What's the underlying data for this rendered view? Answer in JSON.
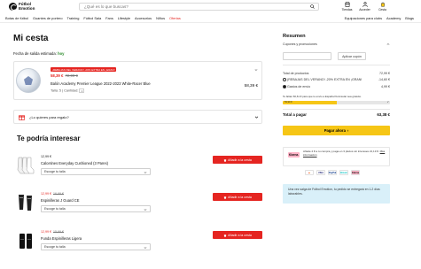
{
  "header": {
    "logo_text": "Fútbol Emotion",
    "search_placeholder": "¿Qué es lo que buscas?",
    "icons": [
      {
        "name": "tiendas",
        "label": "Tiendas",
        "icon": "store-icon"
      },
      {
        "name": "acceder",
        "label": "Acceder",
        "icon": "user-icon"
      },
      {
        "name": "cesta",
        "label": "Cesta",
        "icon": "cart-icon"
      }
    ]
  },
  "nav": {
    "left": [
      "Botas de fútbol",
      "Guantes de portero",
      "Training",
      "Fútbol Sala",
      "Fans",
      "Lifestyle",
      "Accesorios",
      "Niños",
      "Ofertas"
    ],
    "right": [
      "Equipaciones para clubs",
      "Academy",
      "Blogs"
    ]
  },
  "cart": {
    "title": "Mi cesta",
    "delivery_label": "Fecha de salida estimada:",
    "delivery_value": "hoy",
    "item": {
      "badge": "¡REBAJAS DEL VERANO! -20% EXTRA EN ¡GRAN!",
      "price_new": "58,39 €",
      "price_old": "72,99 €",
      "name": "Balón Academy Premier League 2022-2023 White-Racer Blue",
      "meta_size": "Talla: 5",
      "meta_qty_label": "Cantidad:",
      "qty": "1",
      "total": "58,39 €"
    },
    "gift_label": "¿Lo quieres para regalo?"
  },
  "recommend": {
    "title": "Te podría interesar",
    "items": [
      {
        "price_new": "12,99 €",
        "price_old": "",
        "name": "Calcetines Everyday Cushioned (3 Pares)",
        "select": "Escoge tu talla",
        "button": "Añadir a la cesta",
        "icon": "socks-icon"
      },
      {
        "price_new": "12,99 €",
        "price_old": "16,99 €",
        "name": "Espinilleras J Guard CE",
        "select": "Escoge tu talla",
        "button": "Añadir a la cesta",
        "icon": "shinguards-icon"
      },
      {
        "price_new": "12,99 €",
        "price_old": "15,99 €",
        "name": "Funda Espinilleras Ligera",
        "select": "Escoge tu talla",
        "button": "Añadir a la cesta",
        "icon": "sleeves-icon"
      }
    ]
  },
  "summary": {
    "title": "Resumen",
    "coupon_label": "Cupones y promociones",
    "coupon_button": "Aplicar cupón",
    "lines": [
      {
        "label": "Total de productos",
        "value": "72,99 €"
      },
      {
        "label": "(REBAJAS DEL VERANO! -20% EXTRA EN ¡GRAN!",
        "value": "-14,60 €"
      },
      {
        "label": "Gastos de envío",
        "value": "4,99 €"
      }
    ],
    "freeship_text": "Te faltan 60,61 € para que tu envío a España Peninsular sea gratuito.",
    "freeship_amount": "59,99 €",
    "progress_fraction": 0.5,
    "total_label": "Total a pagar",
    "total_value": "63,38 €",
    "pay_button": "Pagar ahora",
    "klarna_badge": "Klarna.",
    "klarna_text": "Añade 2 € a tu compra y paga en 3 plazos sin intereses 21,13 €. ",
    "klarna_link": "Más información",
    "payments": [
      "MC",
      "VISA",
      "PayPal",
      "Bizum",
      "Klarna"
    ],
    "promo_box": "Una vez salga de Fútbol Emotion, tu pedido se entregará en 1-2 días laborables."
  },
  "colors": {
    "accent_red": "#e52521",
    "yellow": "#f6c616",
    "blue_box": "#d9f0f9",
    "klarna": "#ffb3c7"
  }
}
